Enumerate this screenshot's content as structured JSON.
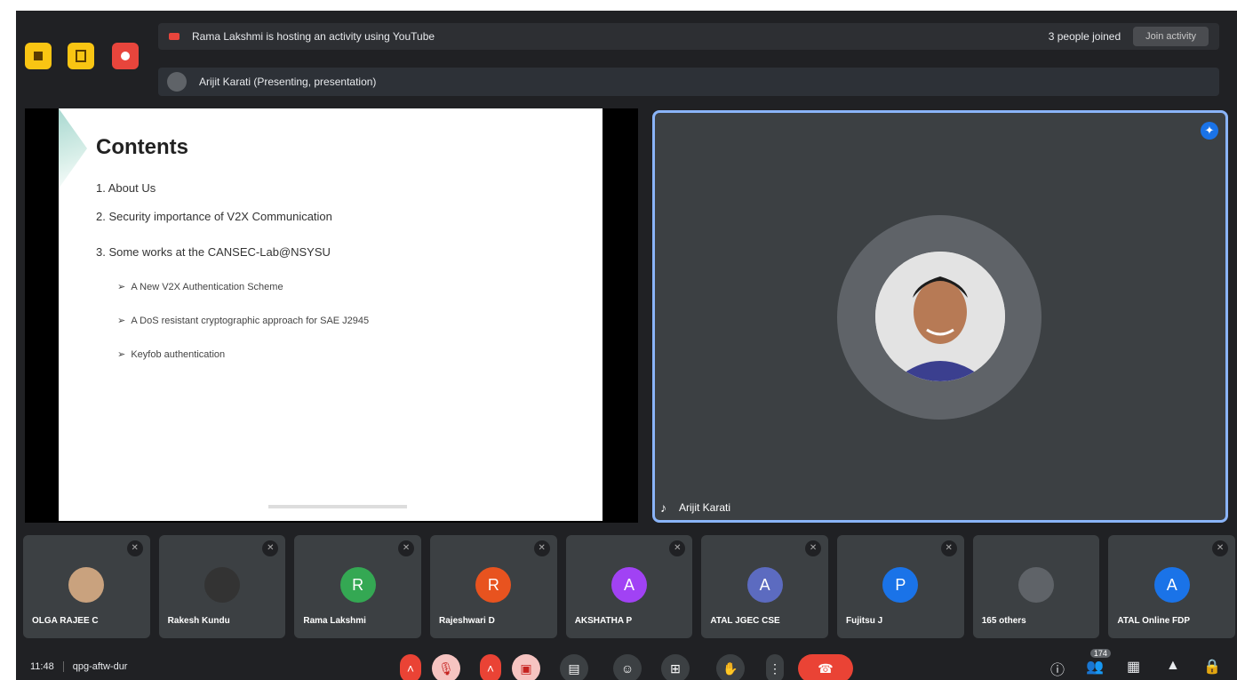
{
  "banners": {
    "activity_text": "Rama Lakshmi is hosting an activity using YouTube",
    "activity_sub": "3 people joined",
    "activity_button": "Join activity",
    "presenting_text": "Arijit Karati (Presenting, presentation)"
  },
  "slide": {
    "title": "Contents",
    "items": [
      "1.  About Us",
      "2.  Security importance of V2X Communication",
      "3.  Some works at the CANSEC-Lab@NSYSU"
    ],
    "subitems": [
      "A New V2X Authentication Scheme",
      "A DoS resistant cryptographic approach for SAE J2945",
      "Keyfob authentication"
    ]
  },
  "speaker": {
    "name": "Arijit Karati"
  },
  "participants": [
    {
      "name": "OLGA RAJEE C",
      "initial": "",
      "color": "#c9a27e",
      "photo": true
    },
    {
      "name": "Rakesh Kundu",
      "initial": "",
      "color": "#333333",
      "photo": true
    },
    {
      "name": "Rama Lakshmi",
      "initial": "R",
      "color": "#34a853"
    },
    {
      "name": "Rajeshwari D",
      "initial": "R",
      "color": "#e8531f"
    },
    {
      "name": "AKSHATHA P",
      "initial": "A",
      "color": "#a142f4"
    },
    {
      "name": "ATAL JGEC CSE",
      "initial": "A",
      "color": "#5c6bc0"
    },
    {
      "name": "Fujitsu J",
      "initial": "P",
      "color": "#1a73e8"
    },
    {
      "name": "165 others",
      "initial": "",
      "color": "#5f6368",
      "photo": true
    },
    {
      "name": "ATAL Online FDP",
      "initial": "A",
      "color": "#1a73e8"
    }
  ],
  "bottom": {
    "time": "11:48",
    "code": "qpg-aftw-dur",
    "people_count": "174"
  },
  "icons": {
    "mic": "mic-icon",
    "camera": "camera-icon",
    "captions": "captions-icon",
    "emoji": "emoji-icon",
    "present": "present-icon",
    "hand": "raise-hand-icon",
    "more": "more-icon",
    "end": "end-call-icon"
  }
}
